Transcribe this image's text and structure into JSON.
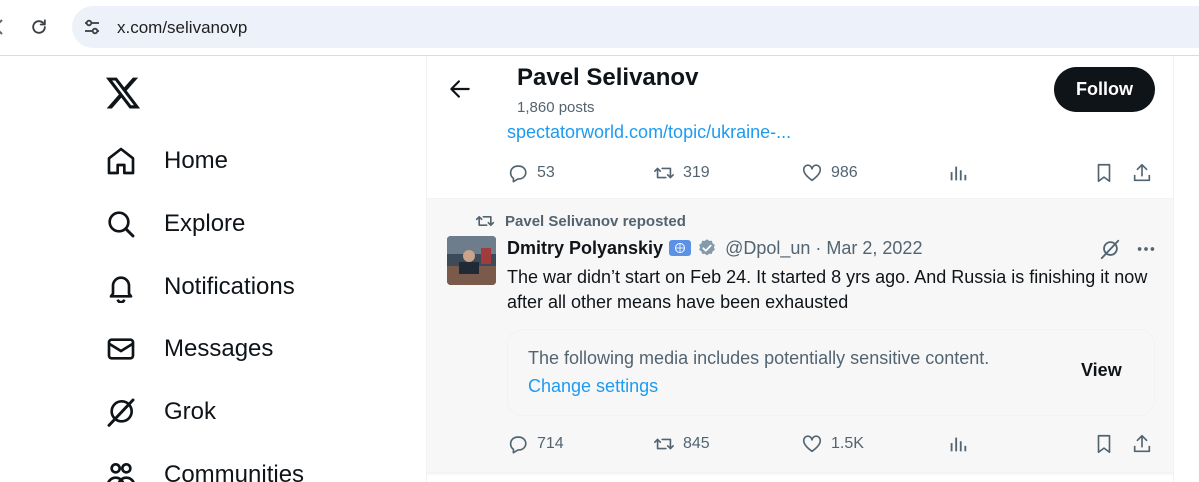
{
  "browser": {
    "url": "x.com/selivanovp"
  },
  "sidebar": {
    "items": [
      {
        "label": "Home",
        "icon": "home-icon"
      },
      {
        "label": "Explore",
        "icon": "search-icon"
      },
      {
        "label": "Notifications",
        "icon": "bell-icon"
      },
      {
        "label": "Messages",
        "icon": "mail-icon"
      },
      {
        "label": "Grok",
        "icon": "grok-icon"
      },
      {
        "label": "Communities",
        "icon": "communities-icon"
      }
    ]
  },
  "header": {
    "name": "Pavel Selivanov",
    "posts": "1,860 posts",
    "follow_label": "Follow"
  },
  "post1": {
    "link": "spectatorworld.com/topic/ukraine-...",
    "replies": "53",
    "reposts": "319",
    "likes": "986"
  },
  "post2": {
    "repost_label": "Pavel Selivanov reposted",
    "author": "Dmitry Polyanskiy",
    "handle": "@Dpol_un · Mar 2, 2022",
    "text": "The war didn’t start on Feb 24. It started 8 yrs ago. And Russia is finishing it now after all other means have been exhausted",
    "sensitive_notice": "The following media includes potentially sensitive content.",
    "change_settings": "Change settings",
    "view_label": "View",
    "replies": "714",
    "reposts": "845",
    "likes": "1.5K"
  },
  "colors": {
    "accent": "#1d9bf0",
    "text": "#0f1419",
    "muted": "#536471"
  }
}
